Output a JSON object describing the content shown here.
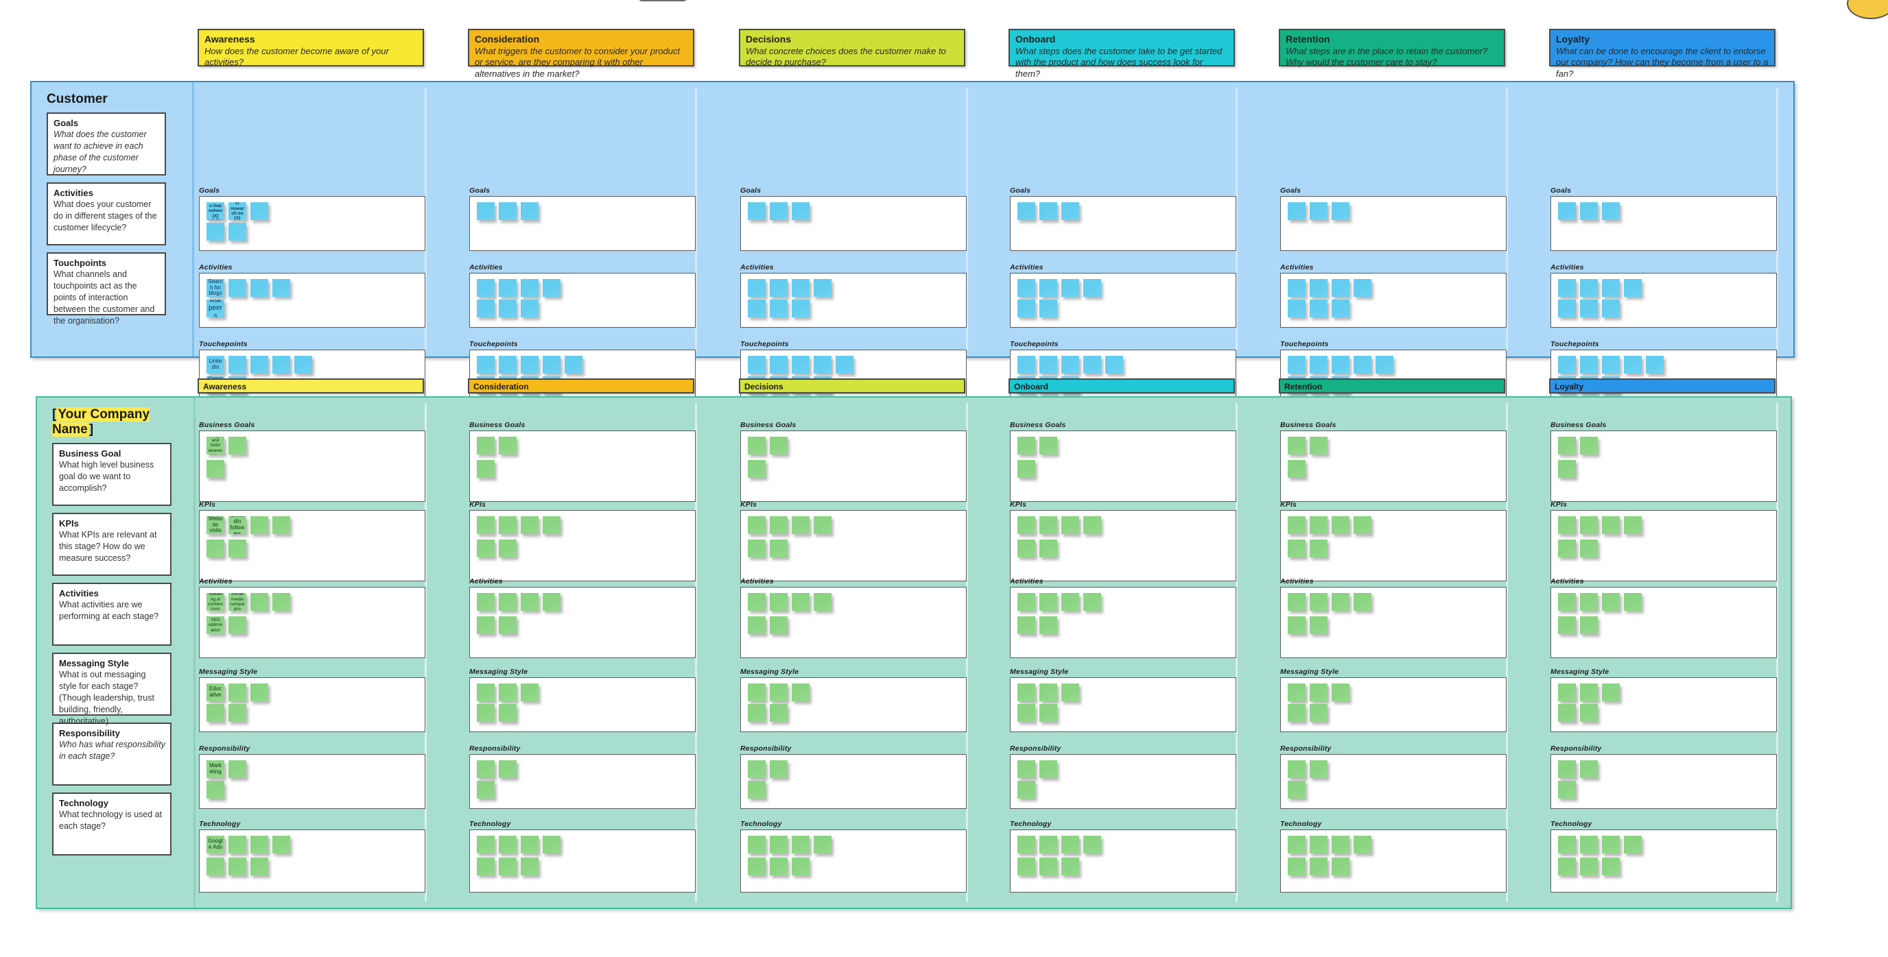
{
  "phases": [
    {
      "key": "awareness",
      "title": "Awareness",
      "question": "How does the customer become aware of your activities?",
      "color": "#f7e832",
      "tab_color": "#f9ec4e"
    },
    {
      "key": "consideration",
      "title": "Consideration",
      "question": "What triggers the customer to consider your product or service, are they comparing it with other alternatives in the market?",
      "color": "#f4b71a",
      "tab_color": "#f5b918"
    },
    {
      "key": "decisions",
      "title": "Decisions",
      "question": "What concrete choices does the customer make to decide to purchase?",
      "color": "#cde038",
      "tab_color": "#d2e33c"
    },
    {
      "key": "onboard",
      "title": "Onboard",
      "question": "What steps does the customer take to be get started with the product and how does success look for them?",
      "color": "#1ec8d4",
      "tab_color": "#1ec8d4"
    },
    {
      "key": "retention",
      "title": "Retention",
      "question": "What steps are in the place to retain the customer? Why would the customer care to stay?",
      "color": "#13b183",
      "tab_color": "#13b183"
    },
    {
      "key": "loyalty",
      "title": "Loyalty",
      "question": "What can be done to encourage the client to endorse our company? How can they become from a user to a fan?",
      "color": "#2a95e8",
      "tab_color": "#2a95e8"
    }
  ],
  "customer": {
    "heading": "Customer",
    "legend": [
      {
        "title": "Goals",
        "body": "What does the customer want to achieve in each phase of the customer journey?",
        "italic": true
      },
      {
        "title": "Activities",
        "body": "What does your customer do in different stages of the customer lifecycle?",
        "italic": false
      },
      {
        "title": "Touchpoints",
        "body": "What channels and touchpoints act as the points of interaction between the customer and the organisation?",
        "italic": false
      }
    ],
    "bands": [
      "Goals",
      "Activities",
      "Touchepoints"
    ],
    "notes": {
      "Goals": [
        "Find a solution that solves [X] problem...",
        "Conduct research on [X] topic...",
        "",
        "",
        ""
      ],
      "Activities": [
        "Search for blogs",
        "",
        "",
        "Ask peers",
        ""
      ],
      "Touchepoints": [
        "LinkedIn",
        "",
        "",
        "",
        "Company Blog",
        "",
        ""
      ]
    }
  },
  "company": {
    "heading_prefix": "[",
    "heading_highlight": "Your Company Name",
    "heading_suffix": "]",
    "heading_full": "[Your Company Name]",
    "legend": [
      {
        "title": "Business Goal",
        "body": "What high level business goal do we want to accomplish?",
        "italic": false
      },
      {
        "title": "KPIs",
        "body": "What KPIs are relevant at this stage? How do we measure success?",
        "italic": false
      },
      {
        "title": "Activities",
        "body": "What activities are we performing at each stage?",
        "italic": false
      },
      {
        "title": "Messaging Style",
        "body": "What is out messaging style for each stage? (Though leadership, trust building, friendly, authoritative)",
        "italic": false
      },
      {
        "title": "Responsibility",
        "body": "Who has what responsibility in each stage?",
        "italic": true
      },
      {
        "title": "Technology",
        "body": "What technology is used at each stage?",
        "italic": false
      }
    ],
    "bands": [
      "Business Goals",
      "KPIs",
      "Activities",
      "Messaging Style",
      "Responsibility",
      "Technology"
    ],
    "notes": {
      "Business Goals": [
        "Target and build awareness...",
        "",
        ""
      ],
      "KPIs": [
        "Website visits",
        "LinkedIn followers",
        "",
        "",
        ""
      ],
      "Activities": [
        "Speaking at conferences",
        "Social media campaigns",
        "",
        "",
        "SEO optimisation",
        ""
      ],
      "Messaging Style": [
        "Educative",
        "",
        "",
        "",
        ""
      ],
      "Responsibility": [
        "Marketing",
        "",
        ""
      ],
      "Technology": [
        "Google Ads",
        "",
        "",
        "",
        "",
        ""
      ]
    }
  },
  "colors": {
    "customer_panel": "#aed8f7",
    "company_panel": "#a8ded0",
    "note_blue": "#63cdf0",
    "note_green": "#8bd482",
    "highlight_yellow": "#ffe94d"
  }
}
